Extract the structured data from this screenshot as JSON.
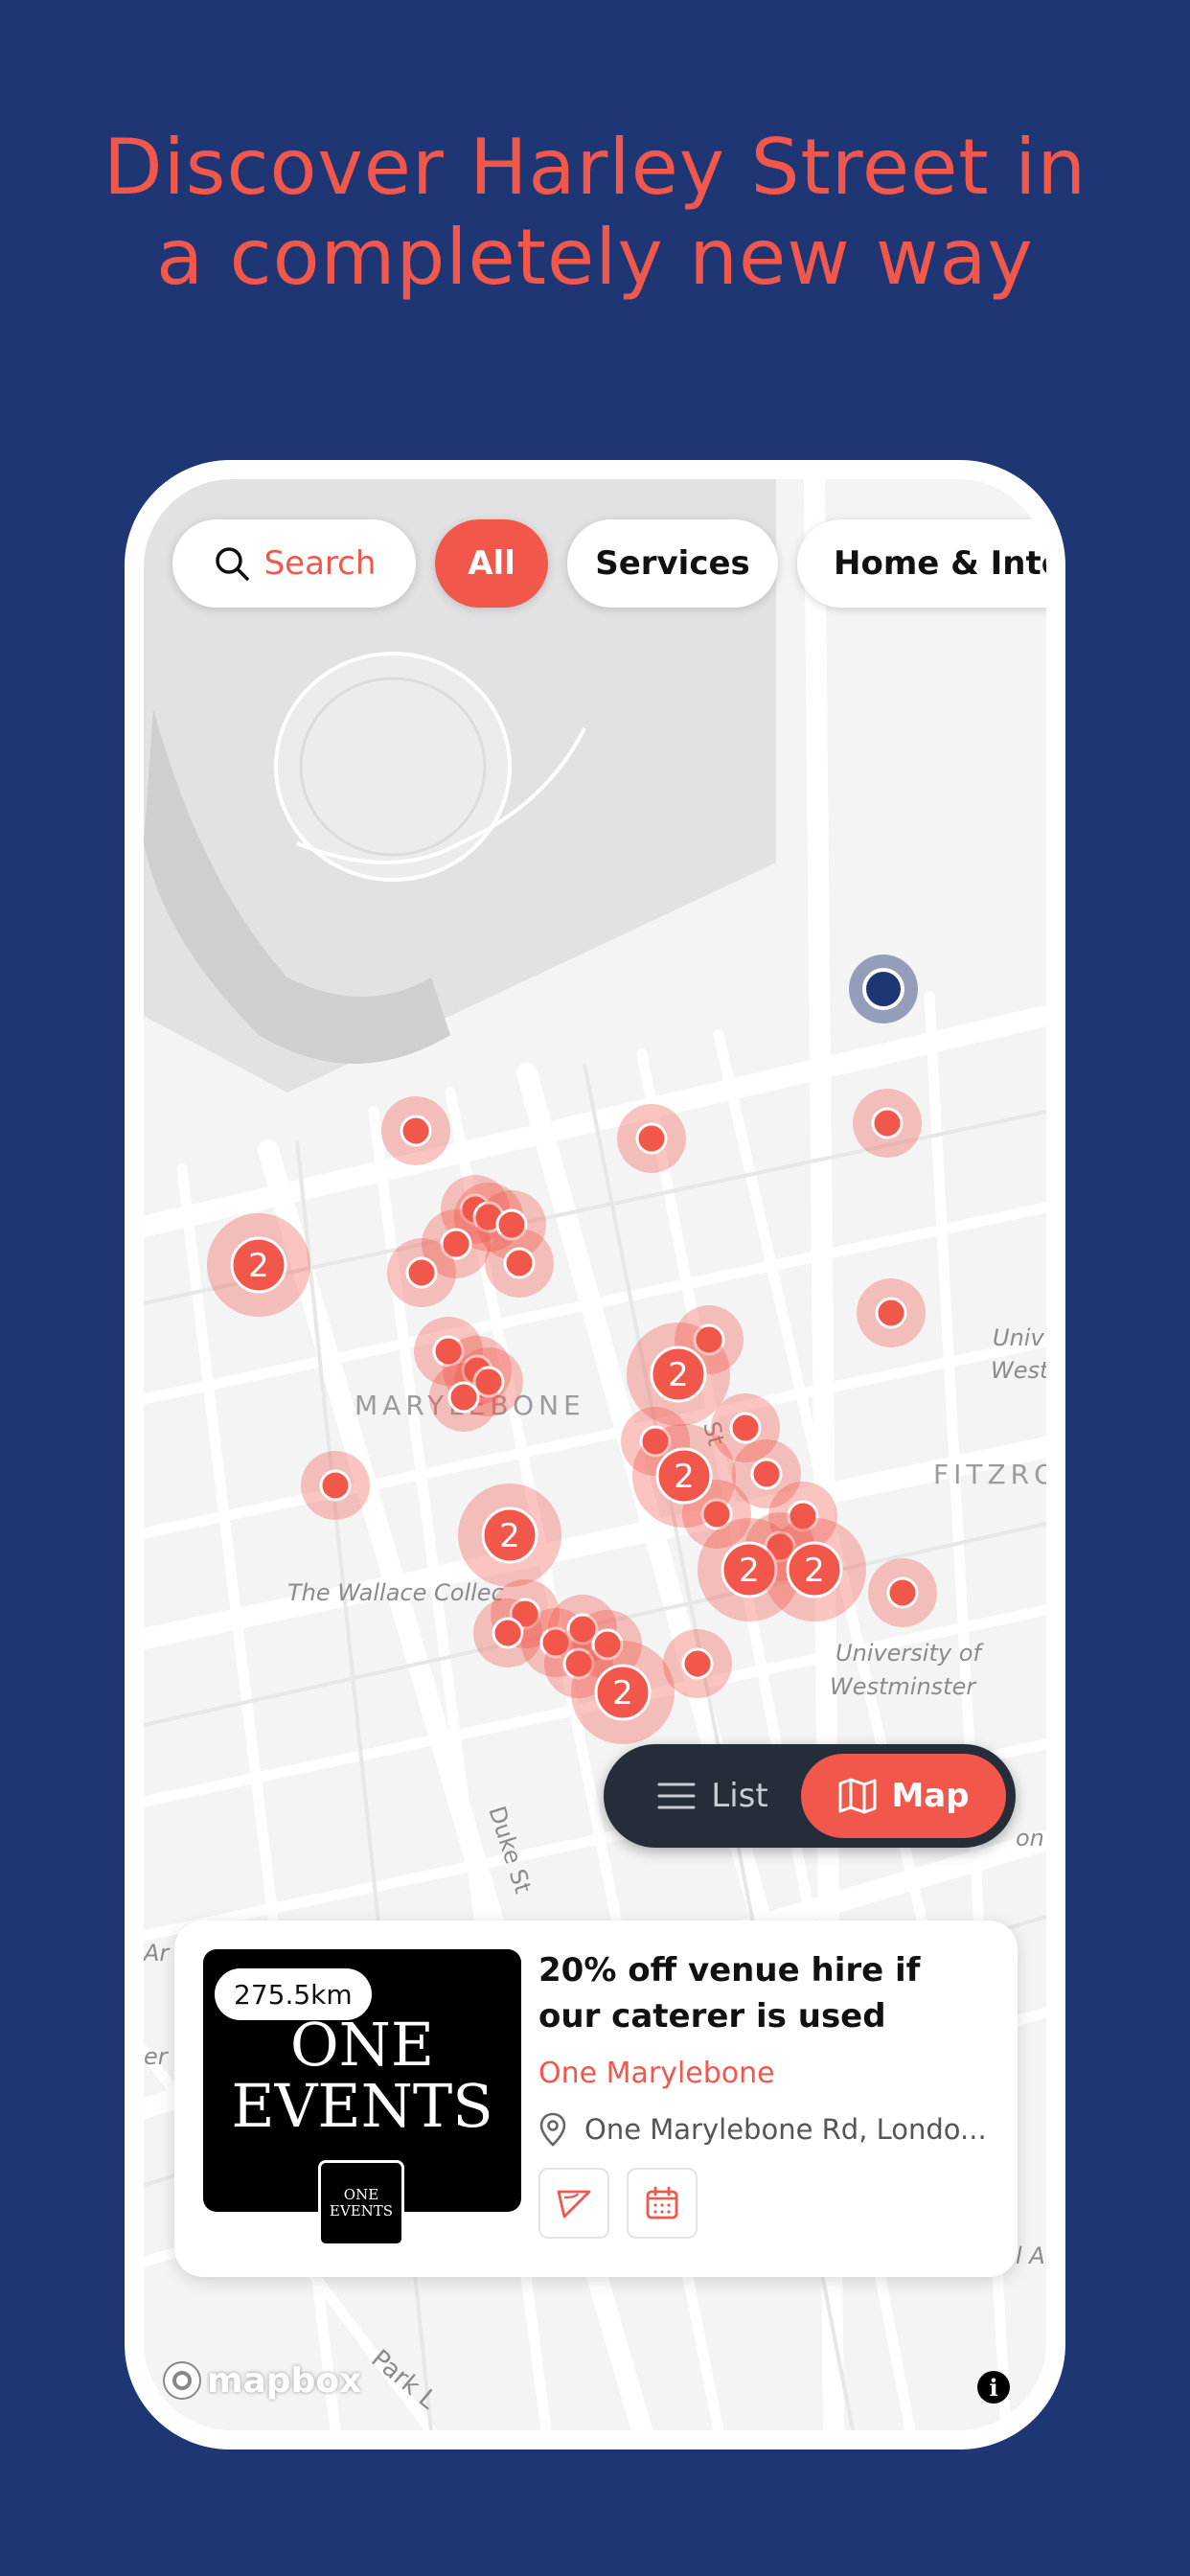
{
  "headline": {
    "line1": "Discover Harley Street in",
    "line2": "a completely new way"
  },
  "filters": {
    "search_label": "Search",
    "chips": [
      "All",
      "Services",
      "Home & Inter"
    ],
    "selected": "All"
  },
  "map": {
    "area_labels": [
      "MARYLEBONE",
      "FITZRO",
      "The Wallace Collec",
      "University of",
      "Westminster",
      "Univ",
      "West",
      "Duke St",
      "Park L",
      "St",
      "Ar",
      "er",
      "on",
      "l A"
    ],
    "cluster_count_label": "2",
    "user_location_color": "#1f3675",
    "marker_color": "#f2574b"
  },
  "view_toggle": {
    "list_label": "List",
    "map_label": "Map",
    "active": "Map"
  },
  "card": {
    "distance": "275.5km",
    "logo_line1": "ONE",
    "logo_line2": "EVENTS",
    "mini_logo_line1": "ONE",
    "mini_logo_line2": "EVENTS",
    "title": "20% off venue hire if our caterer is used",
    "venue": "One Marylebone",
    "address": "One Marylebone Rd, Londo..."
  },
  "attribution": {
    "mapbox": "mapbox",
    "info": "i"
  },
  "colors": {
    "background": "#1f3675",
    "accent": "#f2574b",
    "toggle_dark": "#252d3b"
  }
}
